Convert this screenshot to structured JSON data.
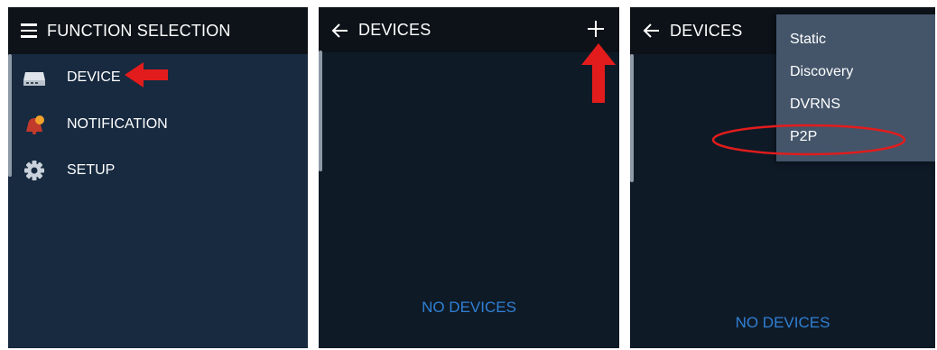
{
  "panel1": {
    "title": "FUNCTION SELECTION",
    "menu": [
      {
        "label": "DEVICE",
        "icon": "dvr-device-icon"
      },
      {
        "label": "NOTIFICATION",
        "icon": "notification-bell-icon"
      },
      {
        "label": "SETUP",
        "icon": "gear-icon"
      }
    ]
  },
  "panel2": {
    "title": "DEVICES",
    "empty_text": "NO DEVICES"
  },
  "panel3": {
    "title": "DEVICES",
    "empty_text": "NO DEVICES",
    "dropdown": [
      "Static",
      "Discovery",
      "DVRNS",
      "P2P"
    ]
  },
  "colors": {
    "panel_bg": "#172a40",
    "devices_bg": "#0f1a27",
    "topbar_bg": "#0c1218",
    "dropdown_bg": "#44556a",
    "empty_text": "#2f80d3",
    "annotation_red": "#e21c1c"
  }
}
